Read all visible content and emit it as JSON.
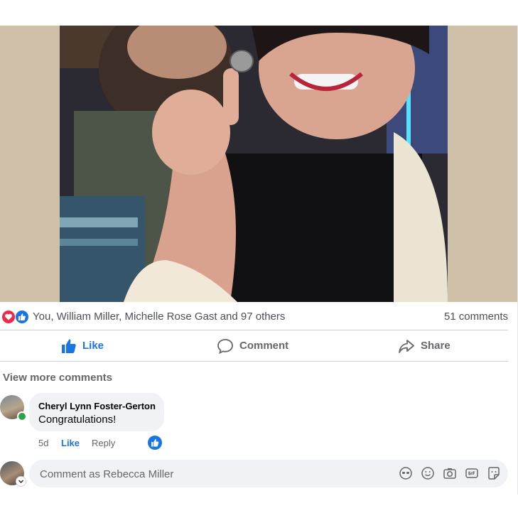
{
  "reactions": {
    "icons": [
      "heart-icon",
      "thumbs-up-icon"
    ],
    "names": "You, William Miller, Michelle Rose Gast and 97 others",
    "comment_count": "51 comments"
  },
  "actions": {
    "like": "Like",
    "comment": "Comment",
    "share": "Share"
  },
  "comments": {
    "view_more": "View more comments",
    "items": [
      {
        "author": "Cheryl Lynn Foster-Gerton",
        "text": "Congratulations!",
        "time": "5d",
        "like_label": "Like",
        "reply_label": "Reply",
        "reaction_icon": "thumbs-up-icon"
      }
    ]
  },
  "composer": {
    "placeholder": "Comment as Rebecca Miller",
    "tools": [
      "avatar-sticker-icon",
      "emoji-icon",
      "camera-icon",
      "gif-icon",
      "sticker-icon"
    ]
  },
  "colors": {
    "accent": "#1b74e4",
    "love": "#f0284a",
    "online": "#31a24c",
    "photo_background": "#cfc0a9"
  }
}
